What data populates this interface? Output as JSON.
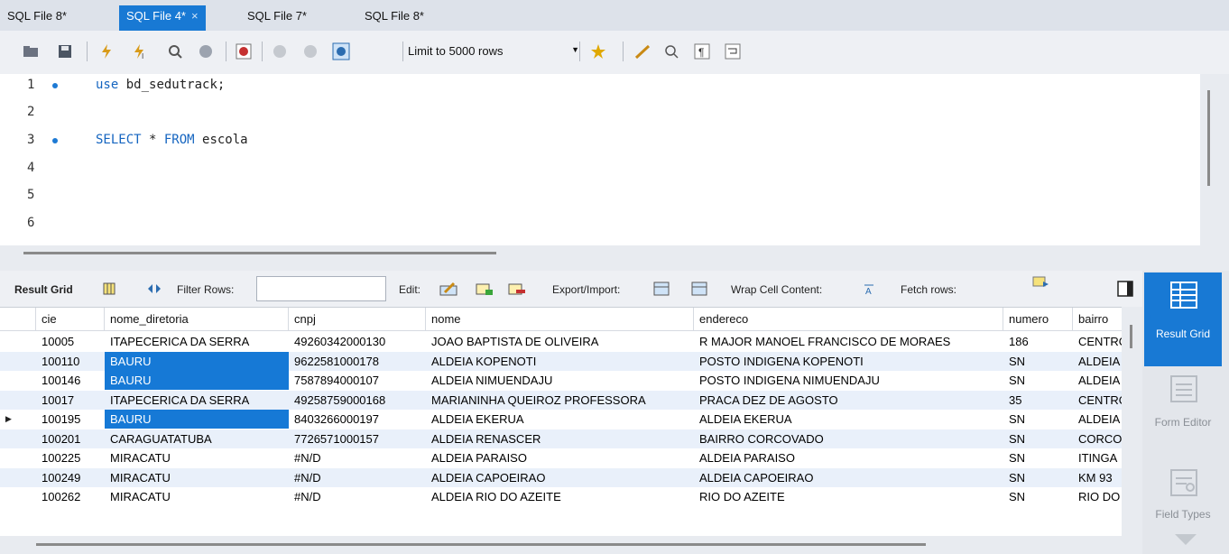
{
  "tabs": [
    {
      "label": "SQL File 8*",
      "active": false
    },
    {
      "label": "SQL File 4*",
      "active": true,
      "close": "×"
    },
    {
      "label": "SQL File 7*",
      "active": false
    },
    {
      "label": "SQL File 8*",
      "active": false
    }
  ],
  "toolbar": {
    "limit_label": "Limit to 5000 rows",
    "icons": [
      "open-folder-icon",
      "save-icon",
      "execute-icon",
      "execute-current-icon",
      "explain-icon",
      "stop-icon",
      "toggle-error-icon",
      "commit-icon",
      "rollback-icon",
      "autocommit-icon",
      "beautify-icon",
      "find-icon",
      "invisible-chars-icon",
      "wrap-icon",
      "add-snippet-icon"
    ]
  },
  "editor": {
    "lines": [
      {
        "num": "1",
        "dot": true,
        "parts": [
          {
            "text": "use",
            "kw": true
          },
          {
            "text": " bd_sedutrack;",
            "kw": false
          }
        ]
      },
      {
        "num": "2",
        "dot": false,
        "parts": []
      },
      {
        "num": "3",
        "dot": true,
        "parts": [
          {
            "text": "SELECT",
            "kw": true
          },
          {
            "text": " * ",
            "kw": false
          },
          {
            "text": "FROM",
            "kw": true
          },
          {
            "text": " escola",
            "kw": false
          }
        ]
      },
      {
        "num": "4",
        "dot": false,
        "parts": []
      },
      {
        "num": "5",
        "dot": false,
        "parts": []
      },
      {
        "num": "6",
        "dot": false,
        "parts": []
      }
    ]
  },
  "result_toolbar": {
    "result_grid": "Result Grid",
    "filter_rows": "Filter Rows:",
    "filter_value": "",
    "edit": "Edit:",
    "export_import": "Export/Import:",
    "wrap_cell": "Wrap Cell Content:",
    "fetch_rows": "Fetch rows:"
  },
  "grid": {
    "columns": [
      "cie",
      "nome_diretoria",
      "cnpj",
      "nome",
      "endereco",
      "numero",
      "bairro"
    ],
    "rows": [
      {
        "cells": [
          "10005",
          "ITAPECERICA DA SERRA",
          "49260342000130",
          "JOAO BAPTISTA DE OLIVEIRA",
          "R MAJOR MANOEL FRANCISCO DE MORAES",
          "186",
          "CENTRO"
        ],
        "sel": false,
        "current": false
      },
      {
        "cells": [
          "100110",
          "BAURU",
          "9622581000178",
          "ALDEIA KOPENOTI",
          "POSTO INDIGENA KOPENOTI",
          "SN",
          "ALDEIA"
        ],
        "sel": true,
        "current": false
      },
      {
        "cells": [
          "100146",
          "BAURU",
          "7587894000107",
          "ALDEIA NIMUENDAJU",
          "POSTO INDIGENA NIMUENDAJU",
          "SN",
          "ALDEIA"
        ],
        "sel": true,
        "current": false
      },
      {
        "cells": [
          "10017",
          "ITAPECERICA DA SERRA",
          "49258759000168",
          "MARIANINHA QUEIROZ PROFESSORA",
          "PRACA DEZ DE AGOSTO",
          "35",
          "CENTRO"
        ],
        "sel": false,
        "current": false
      },
      {
        "cells": [
          "100195",
          "BAURU",
          "8403266000197",
          "ALDEIA EKERUA",
          "ALDEIA EKERUA",
          "SN",
          "ALDEIA"
        ],
        "sel": true,
        "current": true
      },
      {
        "cells": [
          "100201",
          "CARAGUATATUBA",
          "7726571000157",
          "ALDEIA RENASCER",
          "BAIRRO CORCOVADO",
          "SN",
          "CORCOVADO"
        ],
        "sel": false,
        "current": false
      },
      {
        "cells": [
          "100225",
          "MIRACATU",
          "#N/D",
          "ALDEIA PARAISO",
          "ALDEIA PARAISO",
          "SN",
          "ITINGA"
        ],
        "sel": false,
        "current": false
      },
      {
        "cells": [
          "100249",
          "MIRACATU",
          "#N/D",
          "ALDEIA CAPOEIRAO",
          "ALDEIA CAPOEIRAO",
          "SN",
          "KM 93"
        ],
        "sel": false,
        "current": false
      },
      {
        "cells": [
          "100262",
          "MIRACATU",
          "#N/D",
          "ALDEIA RIO DO AZEITE",
          "RIO DO AZEITE",
          "SN",
          "RIO DO AZEITE"
        ],
        "sel": false,
        "current": false
      }
    ]
  },
  "side_panel": {
    "result_grid": "Result Grid",
    "form_editor": "Form Editor",
    "field_types": "Field Types"
  }
}
